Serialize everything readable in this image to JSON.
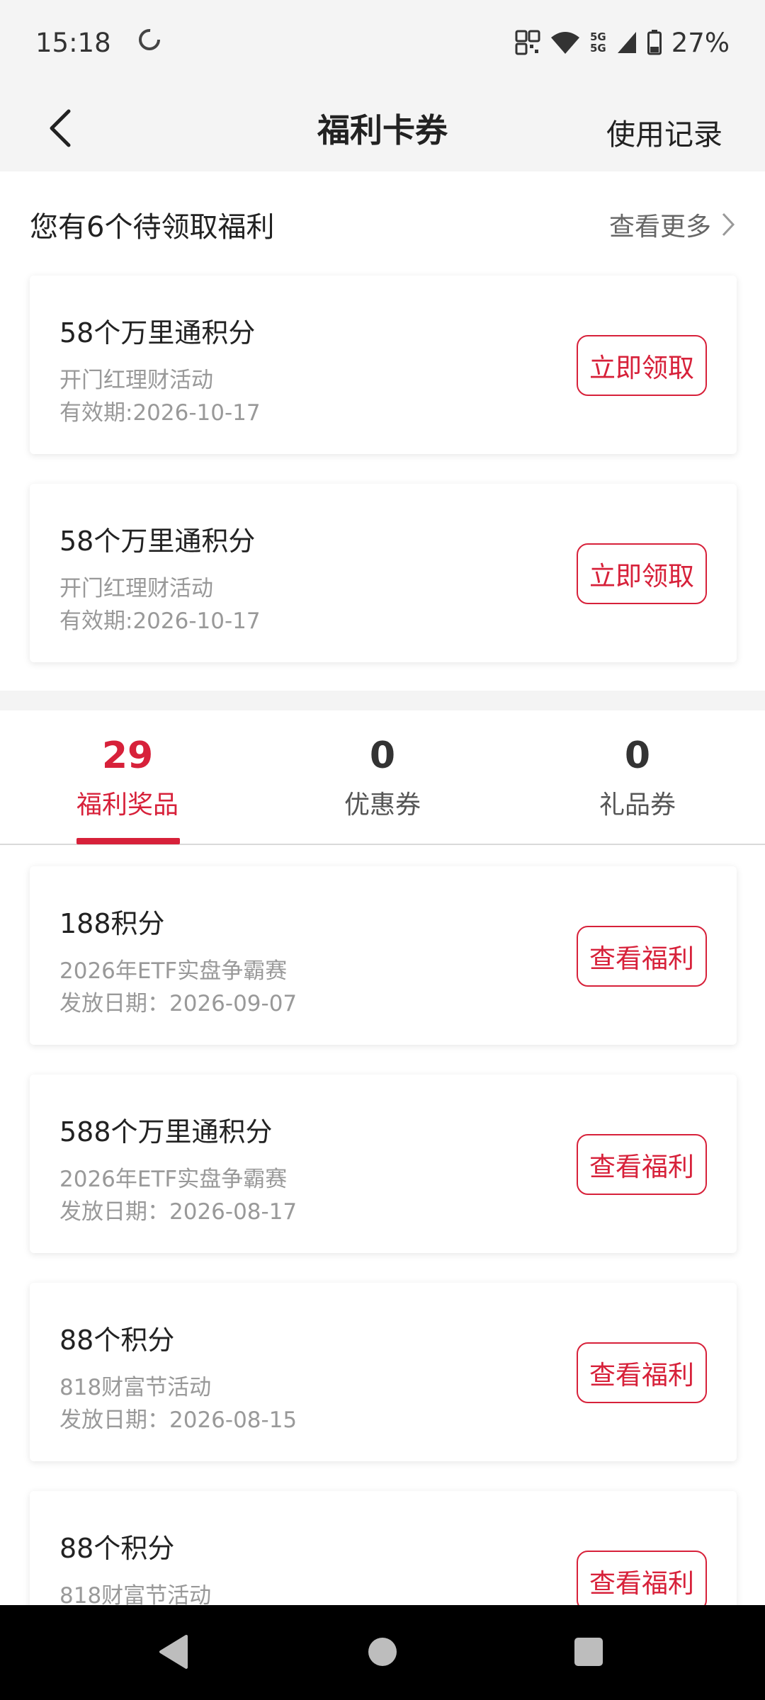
{
  "status_bar": {
    "time": "15:18",
    "network_label_1": "5G",
    "network_label_2": "5G",
    "battery": "27%"
  },
  "nav": {
    "title": "福利卡券",
    "right_action": "使用记录"
  },
  "pending": {
    "title": "您有6个待领取福利",
    "more": "查看更多",
    "items": [
      {
        "title": "58个万里通积分",
        "subtitle": "开门红理财活动",
        "date": "有效期:2026-10-17",
        "button": "立即领取"
      },
      {
        "title": "58个万里通积分",
        "subtitle": "开门红理财活动",
        "date": "有效期:2026-10-17",
        "button": "立即领取"
      }
    ]
  },
  "tabs": [
    {
      "count": "29",
      "label": "福利奖品"
    },
    {
      "count": "0",
      "label": "优惠券"
    },
    {
      "count": "0",
      "label": "礼品券"
    }
  ],
  "rewards": [
    {
      "title": "188积分",
      "subtitle": "2026年ETF实盘争霸赛",
      "date": "发放日期：2026-09-07",
      "button": "查看福利"
    },
    {
      "title": "588个万里通积分",
      "subtitle": "2026年ETF实盘争霸赛",
      "date": "发放日期：2026-08-17",
      "button": "查看福利"
    },
    {
      "title": "88个积分",
      "subtitle": "818财富节活动",
      "date": "发放日期：2026-08-15",
      "button": "查看福利"
    },
    {
      "title": "88个积分",
      "subtitle": "818财富节活动",
      "date": "",
      "button": "查看福利"
    }
  ],
  "colors": {
    "accent": "#d7213a",
    "background": "#f4f4f4",
    "card": "#ffffff",
    "muted_text": "#999999"
  }
}
